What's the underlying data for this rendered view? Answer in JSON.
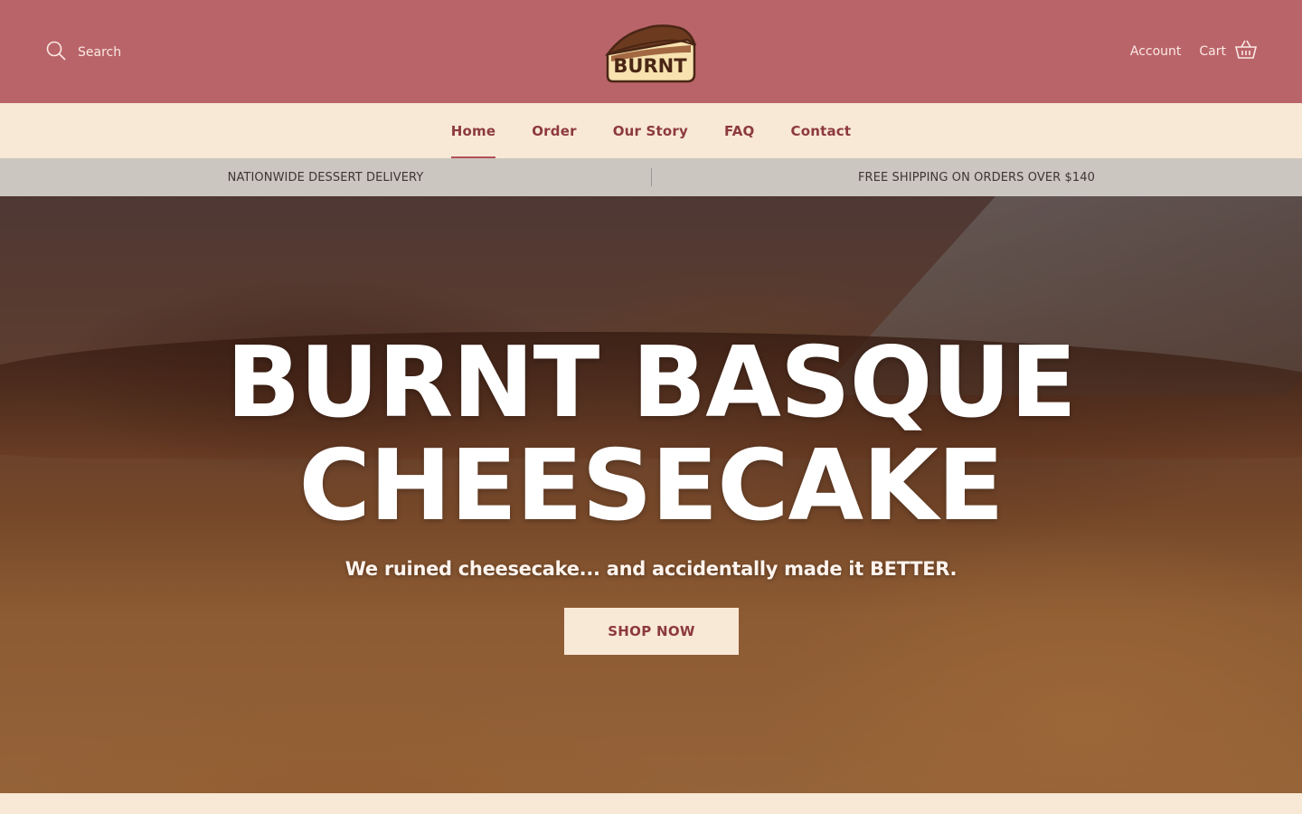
{
  "header": {
    "search_label": "Search",
    "logo_text": "BURNT",
    "account_label": "Account",
    "cart_label": "Cart"
  },
  "nav": {
    "items": [
      {
        "label": "Home",
        "active": true
      },
      {
        "label": "Order",
        "active": false
      },
      {
        "label": "Our Story",
        "active": false
      },
      {
        "label": "FAQ",
        "active": false
      },
      {
        "label": "Contact",
        "active": false
      }
    ]
  },
  "announcement": {
    "left": "NATIONWIDE DESSERT DELIVERY",
    "right": "FREE SHIPPING ON ORDERS OVER $140"
  },
  "hero": {
    "title_line1": "BURNT BASQUE",
    "title_line2": "CHEESECAKE",
    "subtitle": "We ruined cheesecake... and accidentally made it BETTER.",
    "cta_label": "SHOP NOW"
  },
  "colors": {
    "header_bg": "#b96469",
    "cream": "#f8e8d6",
    "nav_text": "#8d3a3c",
    "announce_bg": "#cbc6c0"
  },
  "icons": {
    "search": "search-icon",
    "cart": "basket-icon"
  }
}
